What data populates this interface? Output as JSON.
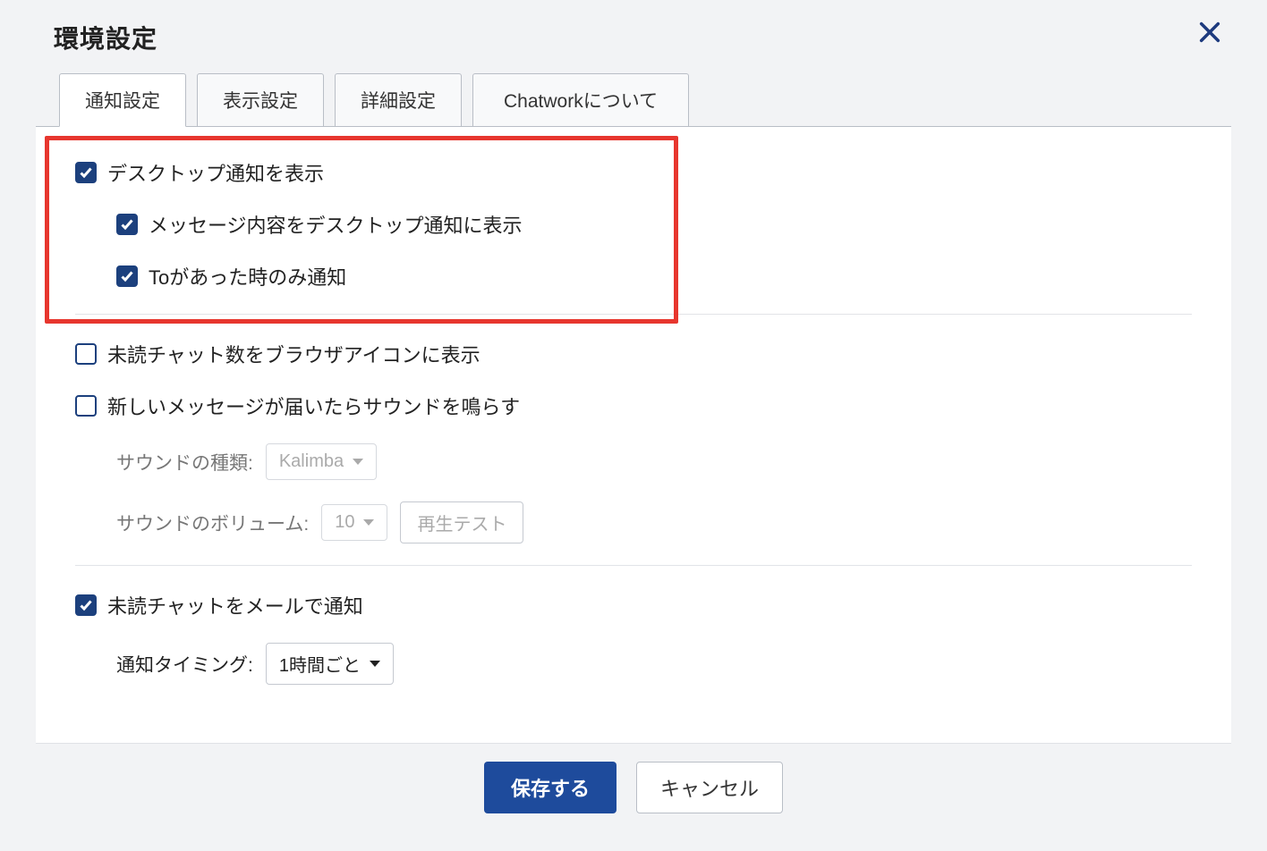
{
  "dialog": {
    "title": "環境設定"
  },
  "tabs": {
    "notification": "通知設定",
    "display": "表示設定",
    "advanced": "詳細設定",
    "about": "Chatworkについて"
  },
  "options": {
    "desktop_notify": "デスクトップ通知を表示",
    "desktop_notify_content": "メッセージ内容をデスクトップ通知に表示",
    "desktop_notify_to_only": "Toがあった時のみ通知",
    "unread_badge": "未読チャット数をブラウザアイコンに表示",
    "sound_on_message": "新しいメッセージが届いたらサウンドを鳴らす",
    "email_notify": "未読チャットをメールで通知"
  },
  "sound": {
    "type_label": "サウンドの種類:",
    "type_value": "Kalimba",
    "volume_label": "サウンドのボリューム:",
    "volume_value": "10",
    "play_test": "再生テスト"
  },
  "email": {
    "timing_label": "通知タイミング:",
    "timing_value": "1時間ごと"
  },
  "footer": {
    "save": "保存する",
    "cancel": "キャンセル"
  }
}
